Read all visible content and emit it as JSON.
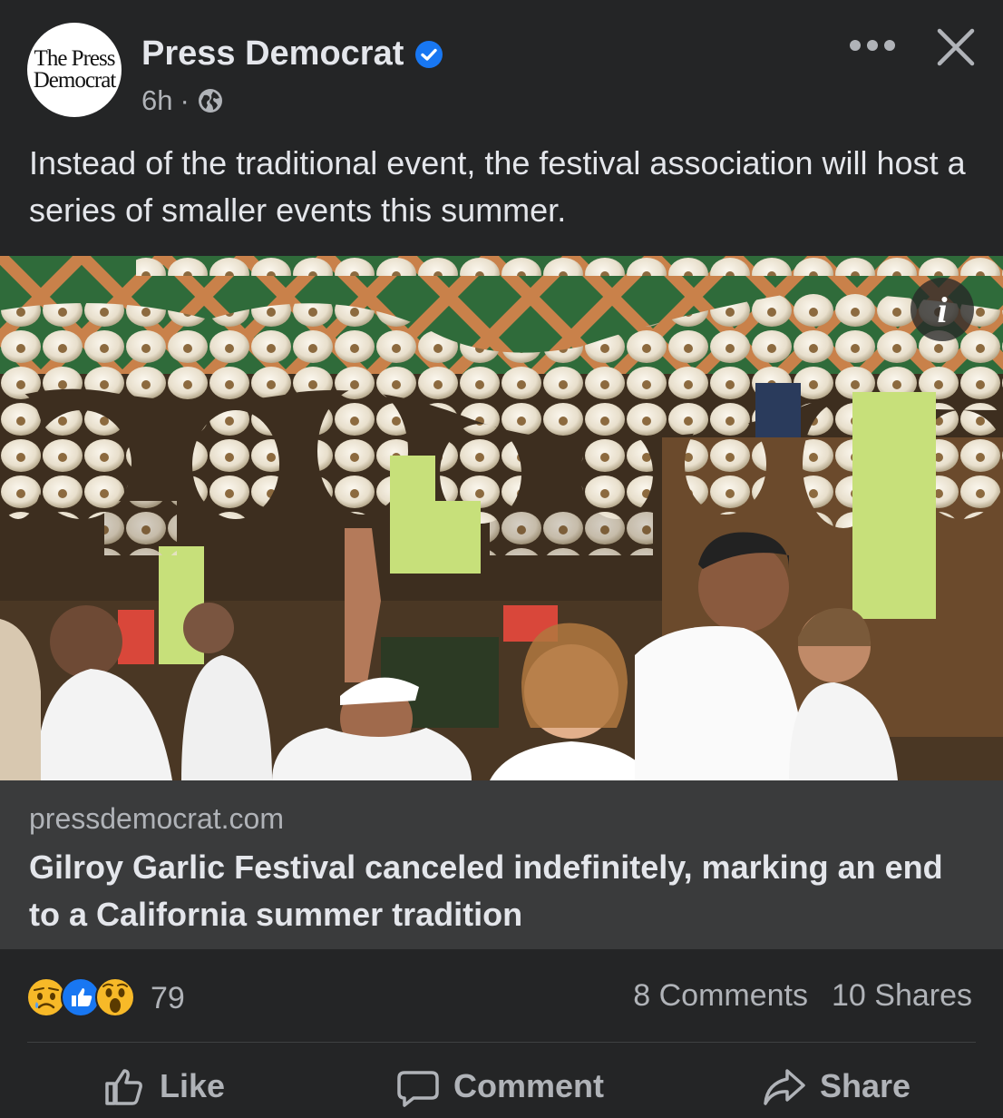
{
  "post": {
    "page": {
      "avatar_line1": "The Press",
      "avatar_line2": "Democrat",
      "name": "Press Democrat",
      "time": "6h",
      "separator": "·"
    },
    "text": "Instead of the traditional event, the festival association will host a series of smaller events this summer.",
    "image": {
      "info_label": "i"
    },
    "link": {
      "domain": "pressdemocrat.com",
      "title": "Gilroy Garlic Festival canceled indefinitely, marking an end to a California summer tradition"
    },
    "engagement": {
      "reaction_count": "79",
      "comments": "8 Comments",
      "shares": "10 Shares"
    },
    "actions": {
      "like": "Like",
      "comment": "Comment",
      "share": "Share"
    }
  },
  "icons": [
    "verified-icon",
    "globe-icon",
    "more-icon",
    "close-icon",
    "info-icon",
    "sad-reaction-icon",
    "like-reaction-icon",
    "wow-reaction-icon",
    "thumbs-up-icon",
    "comment-icon",
    "share-icon"
  ],
  "colors": {
    "background": "#242526",
    "link_background": "#3a3b3c",
    "primary_text": "#e4e6eb",
    "secondary_text": "#b0b3b8",
    "verified": "#1877f2",
    "like_blue": "#1877f2",
    "reaction_yellow": "#f7b928"
  }
}
